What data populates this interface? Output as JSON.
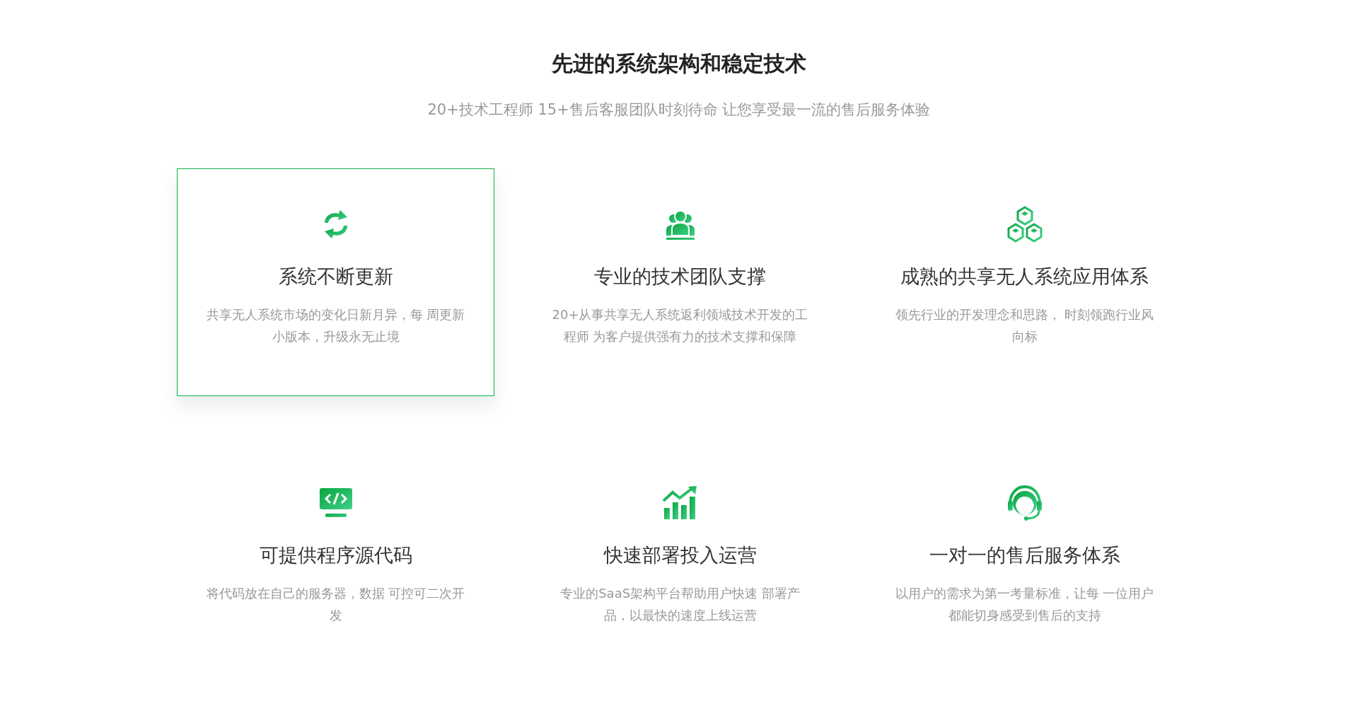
{
  "heading": {
    "title": "先进的系统架构和稳定技术",
    "subtitle": "20+技术工程师 15+售后客服团队时刻待命 让您享受最一流的售后服务体验"
  },
  "features": [
    {
      "kind": "refresh",
      "title": "系统不断更新",
      "description": "共享无人系统市场的变化日新月异，每 周更新小版本，升级永无止境",
      "highlighted": true
    },
    {
      "kind": "team",
      "title": "专业的技术团队支撑",
      "description": "20+从事共享无人系统返利领域技术开发的工程师 为客户提供强有力的技术支撑和保障",
      "highlighted": false
    },
    {
      "kind": "cubes",
      "title": "成熟的共享无人系统应用体系",
      "description": "领先行业的开发理念和思路， 时刻领跑行业风向标",
      "highlighted": false
    },
    {
      "kind": "code",
      "title": "可提供程序源代码",
      "description": "将代码放在自己的服务器，数据 可控可二次开发",
      "highlighted": false
    },
    {
      "kind": "chart",
      "title": "快速部署投入运营",
      "description": "专业的SaaS架构平台帮助用户快速 部署产品，以最快的速度上线运营",
      "highlighted": false
    },
    {
      "kind": "support",
      "title": "一对一的售后服务体系",
      "description": "以用户的需求为第一考量标准，让每 一位用户都能切身感受到售后的支持",
      "highlighted": false
    }
  ]
}
